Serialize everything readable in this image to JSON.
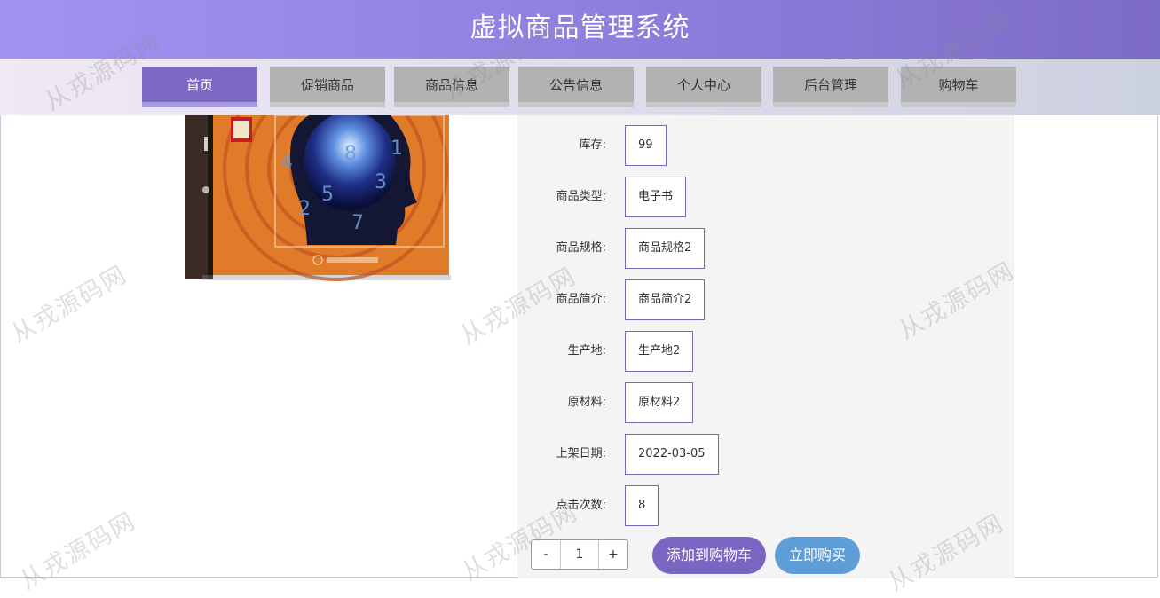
{
  "app": {
    "title": "虚拟商品管理系统"
  },
  "nav": {
    "items": [
      {
        "label": "首页",
        "active": true
      },
      {
        "label": "促销商品",
        "active": false
      },
      {
        "label": "商品信息",
        "active": false
      },
      {
        "label": "公告信息",
        "active": false
      },
      {
        "label": "个人中心",
        "active": false
      },
      {
        "label": "后台管理",
        "active": false
      },
      {
        "label": "购物车",
        "active": false
      }
    ]
  },
  "product": {
    "fields": [
      {
        "label": "库存:",
        "value": "99"
      },
      {
        "label": "商品类型:",
        "value": "电子书"
      },
      {
        "label": "商品规格:",
        "value": "商品规格2"
      },
      {
        "label": "商品简介:",
        "value": "商品简介2"
      },
      {
        "label": "生产地:",
        "value": "生产地2"
      },
      {
        "label": "原材料:",
        "value": "原材料2"
      },
      {
        "label": "上架日期:",
        "value": "2022-03-05"
      },
      {
        "label": "点击次数:",
        "value": "8"
      }
    ]
  },
  "quantity": {
    "minus": "-",
    "value": "1",
    "plus": "+"
  },
  "actions": {
    "add_to_cart": "添加到购物车",
    "buy_now": "立即购买"
  },
  "watermark": {
    "text": "从戎源码网"
  },
  "colors": {
    "header_start": "#a192f3",
    "header_end": "#7d6cc6",
    "nav_active": "#7d68c4",
    "nav_inactive": "#b2b2b2",
    "add_to_cart": "#7965c2",
    "buy_now": "#5e9dd6"
  }
}
